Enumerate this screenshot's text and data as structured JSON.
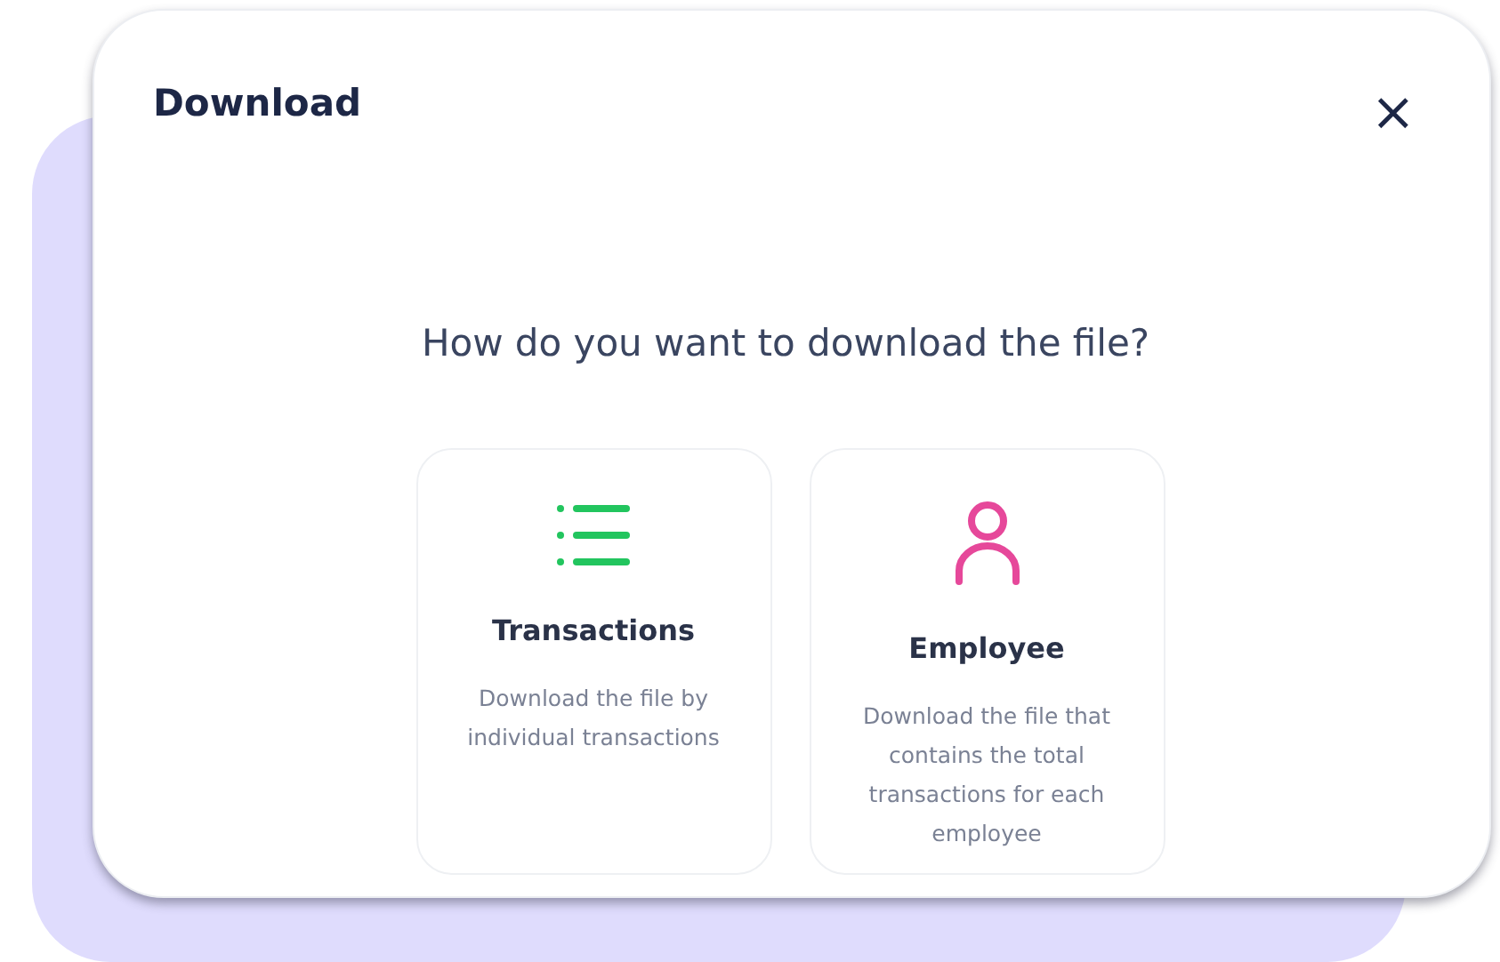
{
  "dialog": {
    "title": "Download",
    "close_label": "×",
    "question": "How do you want to download the file?",
    "options": [
      {
        "kind": "list",
        "color": "#22c55e",
        "title": "Transactions",
        "description": "Download the file by individual transactions"
      },
      {
        "kind": "person",
        "color": "#e6489a",
        "title": "Employee",
        "description": "Download the file that contains the total transactions for each employee"
      }
    ]
  }
}
